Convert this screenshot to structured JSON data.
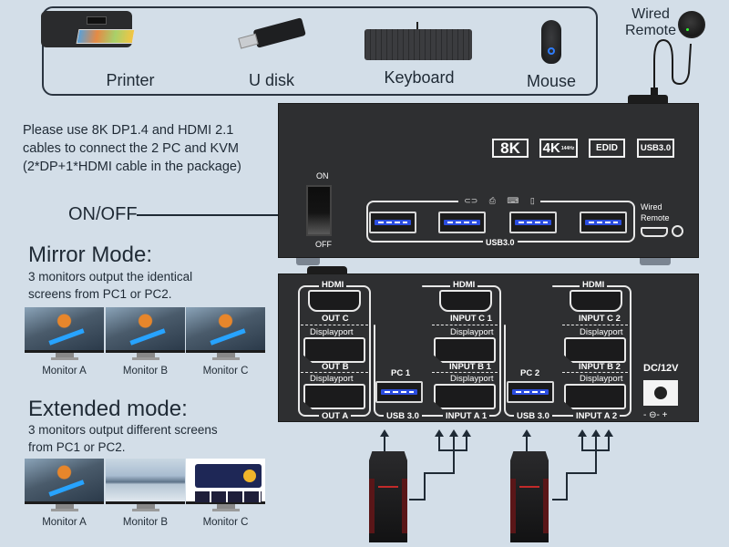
{
  "peripherals": [
    {
      "label": "Printer",
      "icon": "printer-icon"
    },
    {
      "label": "U disk",
      "icon": "usb-drive-icon"
    },
    {
      "label": "Keyboard",
      "icon": "keyboard-icon"
    },
    {
      "label": "Mouse",
      "icon": "mouse-icon"
    }
  ],
  "wired_remote": {
    "label_line1": "Wired",
    "label_line2": "Remote"
  },
  "instructions": {
    "line1": "Please use 8K DP1.4 and HDMI 2.1",
    "line2": "cables to connect the 2 PC and KVM",
    "line3": "(2*DP+1*HDMI cable in the package)"
  },
  "power": {
    "label": "ON/OFF",
    "on": "ON",
    "off": "OFF"
  },
  "front_panel": {
    "badges": [
      "8K",
      "4K",
      "EDID",
      "USB3.0"
    ],
    "badge_4k_sub": "144Hz",
    "usb_group_label": "USB3.0",
    "usb_ports_count": 4,
    "device_icons": [
      "usb-drive-icon",
      "printer-icon",
      "keyboard-icon",
      "mouse-icon"
    ],
    "wired_remote_line1": "Wired",
    "wired_remote_line2": "Remote"
  },
  "mirror_mode": {
    "title": "Mirror Mode:",
    "desc_line1": "3 monitors output the identical",
    "desc_line2": "screens from PC1 or PC2.",
    "monitors": [
      "Monitor A",
      "Monitor B",
      "Monitor C"
    ]
  },
  "extended_mode": {
    "title": "Extended mode:",
    "desc_line1": "3 monitors output different screens",
    "desc_line2": "from PC1 or PC2.",
    "monitors": [
      "Monitor A",
      "Monitor B",
      "Monitor C"
    ]
  },
  "rear_panel": {
    "out_group": {
      "hdmi": "HDMI",
      "out_c": "OUT C",
      "dp1": "Displayport",
      "out_b": "OUT B",
      "dp2": "Displayport",
      "out_a": "OUT A"
    },
    "pc1": {
      "pc": "PC 1",
      "hdmi": "HDMI",
      "input_c": "INPUT C 1",
      "dp1": "Displayport",
      "input_b": "INPUT B 1",
      "dp2": "Displayport",
      "usb": "USB 3.0",
      "input_a": "INPUT A 1"
    },
    "pc2": {
      "pc": "PC 2",
      "hdmi": "HDMI",
      "input_c": "INPUT C 2",
      "dp1": "Displayport",
      "input_b": "INPUT B 2",
      "dp2": "Displayport",
      "usb": "USB 3.0",
      "input_a": "INPUT A 2"
    },
    "dc_label": "DC/12V",
    "polarity": "- ⊖- +"
  }
}
